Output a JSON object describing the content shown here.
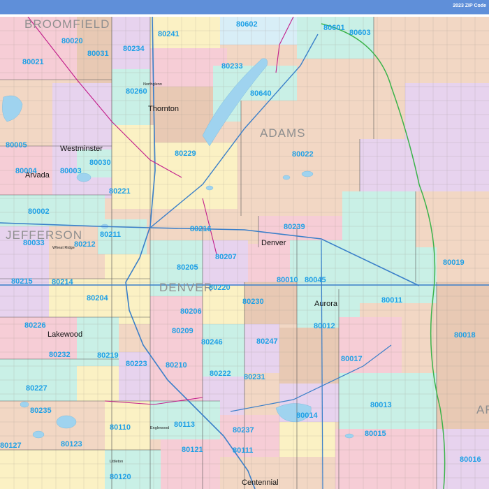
{
  "header": {
    "title": "2023 ZIP Code"
  },
  "colors": {
    "header": "#5f8fd9",
    "zip_label": "#1ea0e6",
    "interstate": "#3a7fc9",
    "us_highway": "#c21c8a",
    "toll_road": "#3bb34a",
    "water": "#9fd3ef"
  },
  "map": {
    "counties": [
      "BROOMFIELD",
      "ADAMS",
      "JEFFERSON",
      "DENVER",
      "ARAPAHOE"
    ],
    "cities": [
      "Westminster",
      "Thornton",
      "Arvada",
      "Denver",
      "Aurora",
      "Lakewood",
      "Centennial"
    ],
    "small_places": [
      "Northglenn",
      "Wheat Ridge",
      "Englewood",
      "Littleton"
    ],
    "zip_codes": [
      "80020",
      "80241",
      "80602",
      "80601",
      "80603",
      "80021",
      "80031",
      "80234",
      "80233",
      "80260",
      "80640",
      "80005",
      "80229",
      "80022",
      "80004",
      "80003",
      "80030",
      "80221",
      "80002",
      "80239",
      "80216",
      "80211",
      "80033",
      "80212",
      "80207",
      "80205",
      "80019",
      "80215",
      "80214",
      "80220",
      "80010",
      "80045",
      "80204",
      "80206",
      "80230",
      "80011",
      "80226",
      "80209",
      "80246",
      "80012",
      "80018",
      "80247",
      "80232",
      "80219",
      "80223",
      "80210",
      "80017",
      "80222",
      "80231",
      "80227",
      "80013",
      "80235",
      "80110",
      "80113",
      "80237",
      "80014",
      "80015",
      "80123",
      "80121",
      "80111",
      "80127",
      "80120",
      "80016"
    ]
  }
}
